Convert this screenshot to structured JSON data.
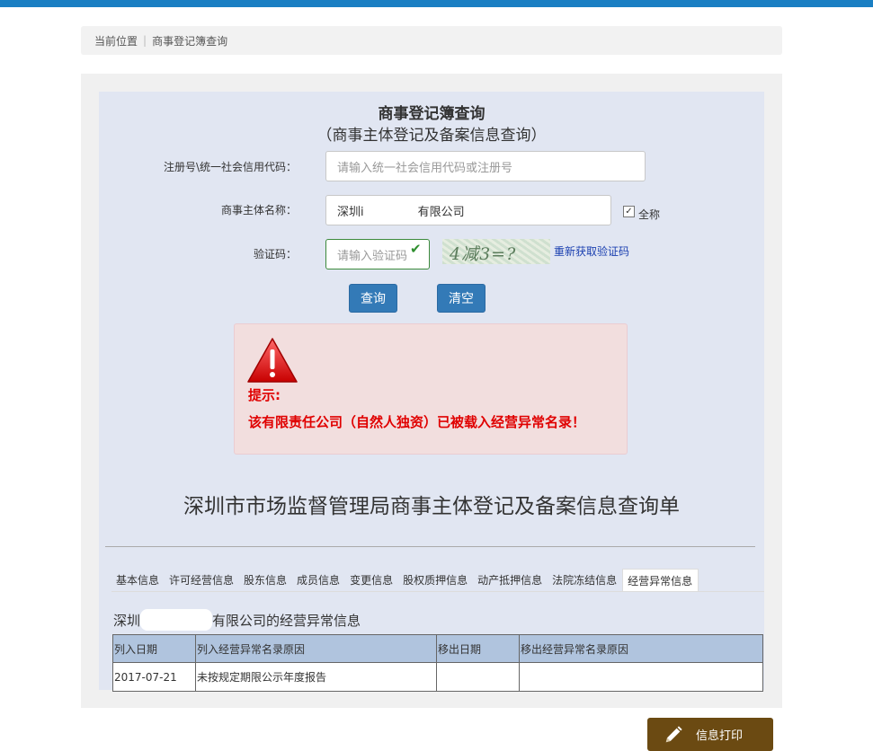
{
  "breadcrumb": {
    "current": "当前位置",
    "page": "商事登记簿查询"
  },
  "form": {
    "title": "商事登记簿查询",
    "subtitle": "（商事主体登记及备案信息查询）",
    "credit_label": "注册号\\统一社会信用代码：",
    "credit_placeholder": "请输入统一社会信用代码或注册号",
    "name_label": "商事主体名称：",
    "name_value_prefix": "深圳i",
    "name_value_suffix": "有限公司",
    "fullname_label": "全称",
    "captcha_label": "验证码：",
    "captcha_placeholder": "请输入验证码",
    "captcha_text": "4减3=?",
    "refresh_label": "重新获取验证码",
    "query_button": "查询",
    "clear_button": "清空"
  },
  "alert": {
    "title": "提示:",
    "message": "该有限责任公司（自然人独资）已被载入经营异常名录！"
  },
  "result": {
    "title": "深圳市市场监督管理局商事主体登记及备案信息查询单",
    "tabs": [
      "基本信息",
      "许可经营信息",
      "股东信息",
      "成员信息",
      "变更信息",
      "股权质押信息",
      "动产抵押信息",
      "法院冻结信息",
      "经营异常信息"
    ],
    "active_tab": "经营异常信息",
    "section_prefix": "深圳",
    "section_suffix": "有限公司的经营异常信息",
    "columns": [
      "列入日期",
      "列入经营异常名录原因",
      "移出日期",
      "移出经营异常名录原因"
    ],
    "rows": [
      [
        "2017-07-21",
        "未按规定期限公示年度报告",
        "",
        ""
      ]
    ]
  },
  "print_button": "信息打印",
  "colors": {
    "topbar": "#1a7fc3",
    "alert_text": "#e00000",
    "button": "#337ab7",
    "print_button": "#6b4a12"
  }
}
